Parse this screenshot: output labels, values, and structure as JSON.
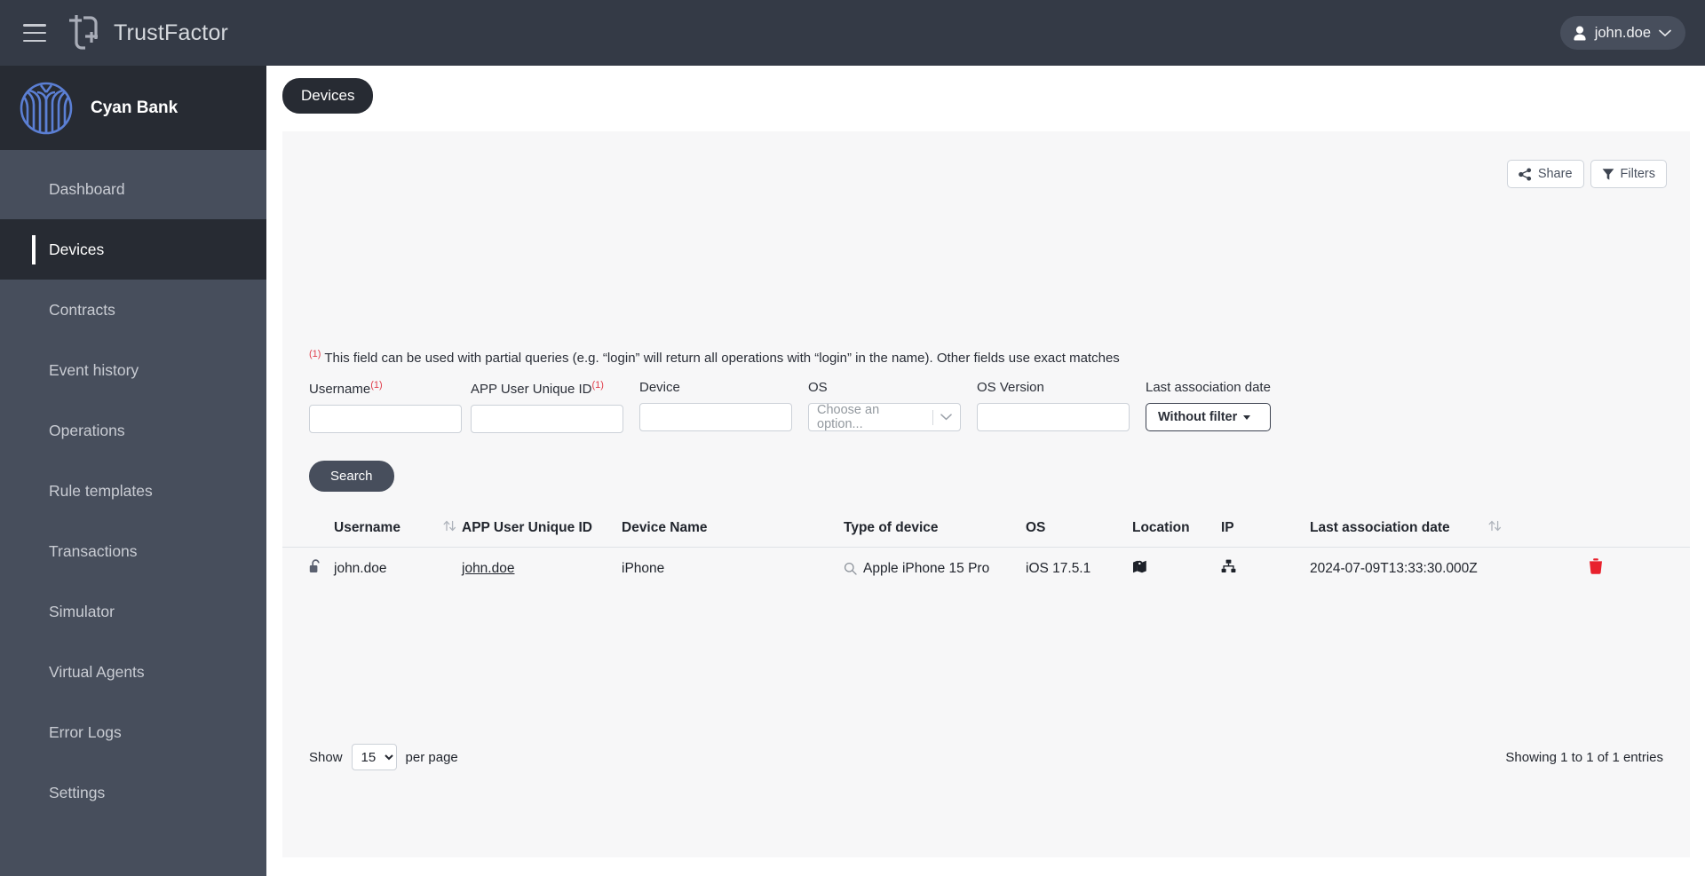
{
  "header": {
    "menu_icon": "hamburger-icon",
    "logo_icon": "trustfactor-logo-icon",
    "app_title": "TrustFactor",
    "user": {
      "name": "john.doe",
      "avatar_icon": "user-avatar-icon",
      "chevron_icon": "chevron-down-icon"
    }
  },
  "sidebar": {
    "tenant_logo_icon": "cyan-bank-logo-icon",
    "tenant_name": "Cyan Bank",
    "items": [
      {
        "label": "Dashboard",
        "active": false
      },
      {
        "label": "Devices",
        "active": true
      },
      {
        "label": "Contracts",
        "active": false
      },
      {
        "label": "Event history",
        "active": false
      },
      {
        "label": "Operations",
        "active": false
      },
      {
        "label": "Rule templates",
        "active": false
      },
      {
        "label": "Transactions",
        "active": false
      },
      {
        "label": "Simulator",
        "active": false
      },
      {
        "label": "Virtual Agents",
        "active": false
      },
      {
        "label": "Error Logs",
        "active": false
      },
      {
        "label": "Settings",
        "active": false
      }
    ]
  },
  "tabs": [
    {
      "label": "Devices",
      "active": true
    }
  ],
  "panel": {
    "actions": {
      "share_label": "Share",
      "share_icon": "share-nodes-icon",
      "filters_label": "Filters",
      "filters_icon": "funnel-icon"
    },
    "notice": {
      "marker": "(1)",
      "text": "This field can be used with partial queries (e.g. “login” will return all operations with “login” in the name). Other fields use exact matches",
      "marker_color": "#e03c4a"
    },
    "filters": {
      "username": {
        "label": "Username",
        "marker": "(1)",
        "value": "",
        "placeholder": ""
      },
      "app_user_unique_id": {
        "label": "APP User Unique ID",
        "marker": "(1)",
        "value": "",
        "placeholder": ""
      },
      "device": {
        "label": "Device",
        "value": "",
        "placeholder": ""
      },
      "os": {
        "label": "OS",
        "selected": "Choose an option...",
        "chevron_icon": "chevron-down-icon"
      },
      "os_version": {
        "label": "OS Version",
        "value": "",
        "placeholder": ""
      },
      "last_association_date": {
        "label": "Last association date",
        "button_label": "Without filter"
      }
    },
    "search_button": "Search"
  },
  "table": {
    "columns": [
      "Username",
      "APP User Unique ID",
      "Device Name",
      "Type of device",
      "OS",
      "Location",
      "IP",
      "Last association date"
    ],
    "sort_icon": "sort-arrows-icon",
    "rows": [
      {
        "lock_icon": "unlock-icon",
        "username": "john.doe",
        "app_user_unique_id": "john.doe",
        "device_name": "iPhone",
        "type_of_device": "Apple iPhone 15 Pro",
        "type_icon": "magnifier-icon",
        "os": "iOS 17.5.1",
        "location_icon": "map-location-icon",
        "ip_icon": "network-sitemap-icon",
        "last_association_date": "2024-07-09T13:33:30.000Z",
        "delete_icon": "trash-icon"
      }
    ],
    "delete_color": "#e8212d"
  },
  "pagination": {
    "show_label": "Show",
    "per_page_label": "per page",
    "page_size": "15",
    "page_size_options": [
      "15"
    ],
    "entries_text": "Showing 1 to 1 of 1 entries"
  }
}
